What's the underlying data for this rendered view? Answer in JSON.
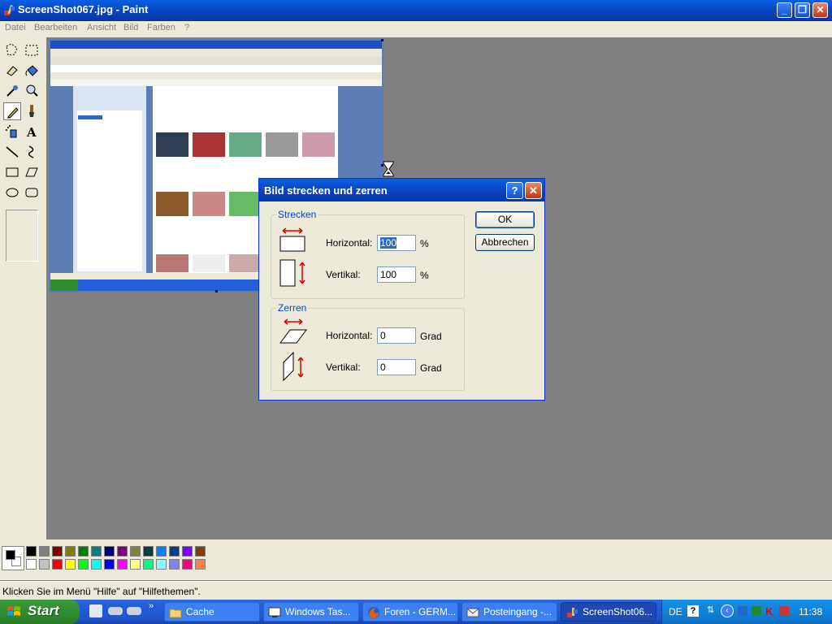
{
  "window": {
    "title": "ScreenShot067.jpg - Paint",
    "minimize_icon": "minimize-icon",
    "maximize_icon": "restore-icon",
    "close_icon": "close-icon"
  },
  "menu": {
    "items": [
      {
        "label": "Datei"
      },
      {
        "label": "Bearbeiten"
      },
      {
        "label": "Ansicht"
      },
      {
        "label": "Bild"
      },
      {
        "label": "Farben"
      },
      {
        "label": "?"
      }
    ]
  },
  "tools": {
    "names": [
      "free-form-select",
      "rect-select",
      "eraser",
      "fill",
      "color-picker",
      "magnifier",
      "pencil",
      "brush",
      "airbrush",
      "text",
      "line",
      "curve",
      "rectangle",
      "polygon",
      "ellipse",
      "rounded-rectangle"
    ],
    "active": "pencil"
  },
  "palette": {
    "foreground": "#000000",
    "background": "#ffffff",
    "row1": [
      "#000000",
      "#808080",
      "#800000",
      "#808000",
      "#008000",
      "#008080",
      "#000080",
      "#800080",
      "#808040",
      "#004040",
      "#0080ff",
      "#004080",
      "#8000ff",
      "#804000"
    ],
    "row2": [
      "#ffffff",
      "#c0c0c0",
      "#ff0000",
      "#ffff00",
      "#00ff00",
      "#00ffff",
      "#0000ff",
      "#ff00ff",
      "#ffff80",
      "#00ff80",
      "#80ffff",
      "#8080ff",
      "#ff0080",
      "#ff8040"
    ]
  },
  "status": {
    "text": "Klicken Sie im Menü \"Hilfe\" auf \"Hilfethemen\"."
  },
  "dialog": {
    "title": "Bild strecken und zerren",
    "help_label": "?",
    "close_label": "✕",
    "stretch": {
      "legend": "Strecken",
      "horizontal_label": "Horizontal:",
      "horizontal_value": "100",
      "horizontal_unit": "%",
      "vertical_label": "Vertikal:",
      "vertical_value": "100",
      "vertical_unit": "%"
    },
    "skew": {
      "legend": "Zerren",
      "horizontal_label": "Horizontal:",
      "horizontal_value": "0",
      "horizontal_unit": "Grad",
      "vertical_label": "Vertikal:",
      "vertical_value": "0",
      "vertical_unit": "Grad"
    },
    "ok_label": "OK",
    "cancel_label": "Abbrechen"
  },
  "taskbar": {
    "start_label": "Start",
    "tasks": [
      {
        "label": "Cache",
        "icon": "folder-icon"
      },
      {
        "label": "Windows Tas...",
        "icon": "task-manager-icon"
      },
      {
        "label": "Foren - GERM...",
        "icon": "firefox-icon"
      },
      {
        "label": "Posteingang -...",
        "icon": "mail-icon"
      },
      {
        "label": "ScreenShot06...",
        "icon": "paint-icon"
      }
    ],
    "tray": {
      "language": "DE",
      "clock": "11:38"
    }
  },
  "colors": {
    "xp_blue": "#0842b9",
    "face": "#ece9d8",
    "canvas_bg": "#808080",
    "start_green": "#2f8f2f",
    "group_label": "#0046d5"
  }
}
